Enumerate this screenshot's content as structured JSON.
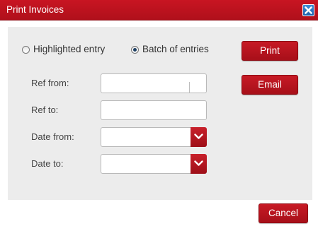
{
  "window": {
    "title": "Print Invoices",
    "close_icon": "close-x-icon"
  },
  "mode": {
    "options": [
      {
        "label": "Highlighted entry",
        "checked": false
      },
      {
        "label": "Batch of entries",
        "checked": true
      }
    ]
  },
  "fields": {
    "ref_from": {
      "label": "Ref from:",
      "value": ""
    },
    "ref_to": {
      "label": "Ref to:",
      "value": ""
    },
    "date_from": {
      "label": "Date from:",
      "value": ""
    },
    "date_to": {
      "label": "Date to:",
      "value": ""
    }
  },
  "actions": {
    "print_label": "Print",
    "email_label": "Email",
    "cancel_label": "Cancel"
  },
  "colors": {
    "accent": "#b8121e",
    "panel": "#ececec",
    "close_button": "#2a73c0"
  }
}
